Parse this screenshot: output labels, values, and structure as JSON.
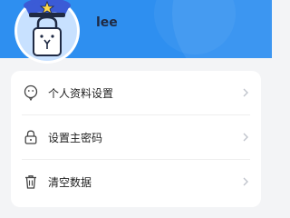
{
  "profile": {
    "username": "lee"
  },
  "menu": {
    "items": [
      {
        "label": "个人资料设置",
        "icon": "smile-face-icon"
      },
      {
        "label": "设置主密码",
        "icon": "lock-icon"
      },
      {
        "label": "清空数据",
        "icon": "trash-icon"
      }
    ]
  },
  "colors": {
    "header": "#2e8ff0",
    "background": "#f3f4f6",
    "card": "#ffffff",
    "avatar_ring": "#c8e1ff",
    "cap": "#3b5bd6",
    "chevron": "#c0c4cc"
  }
}
